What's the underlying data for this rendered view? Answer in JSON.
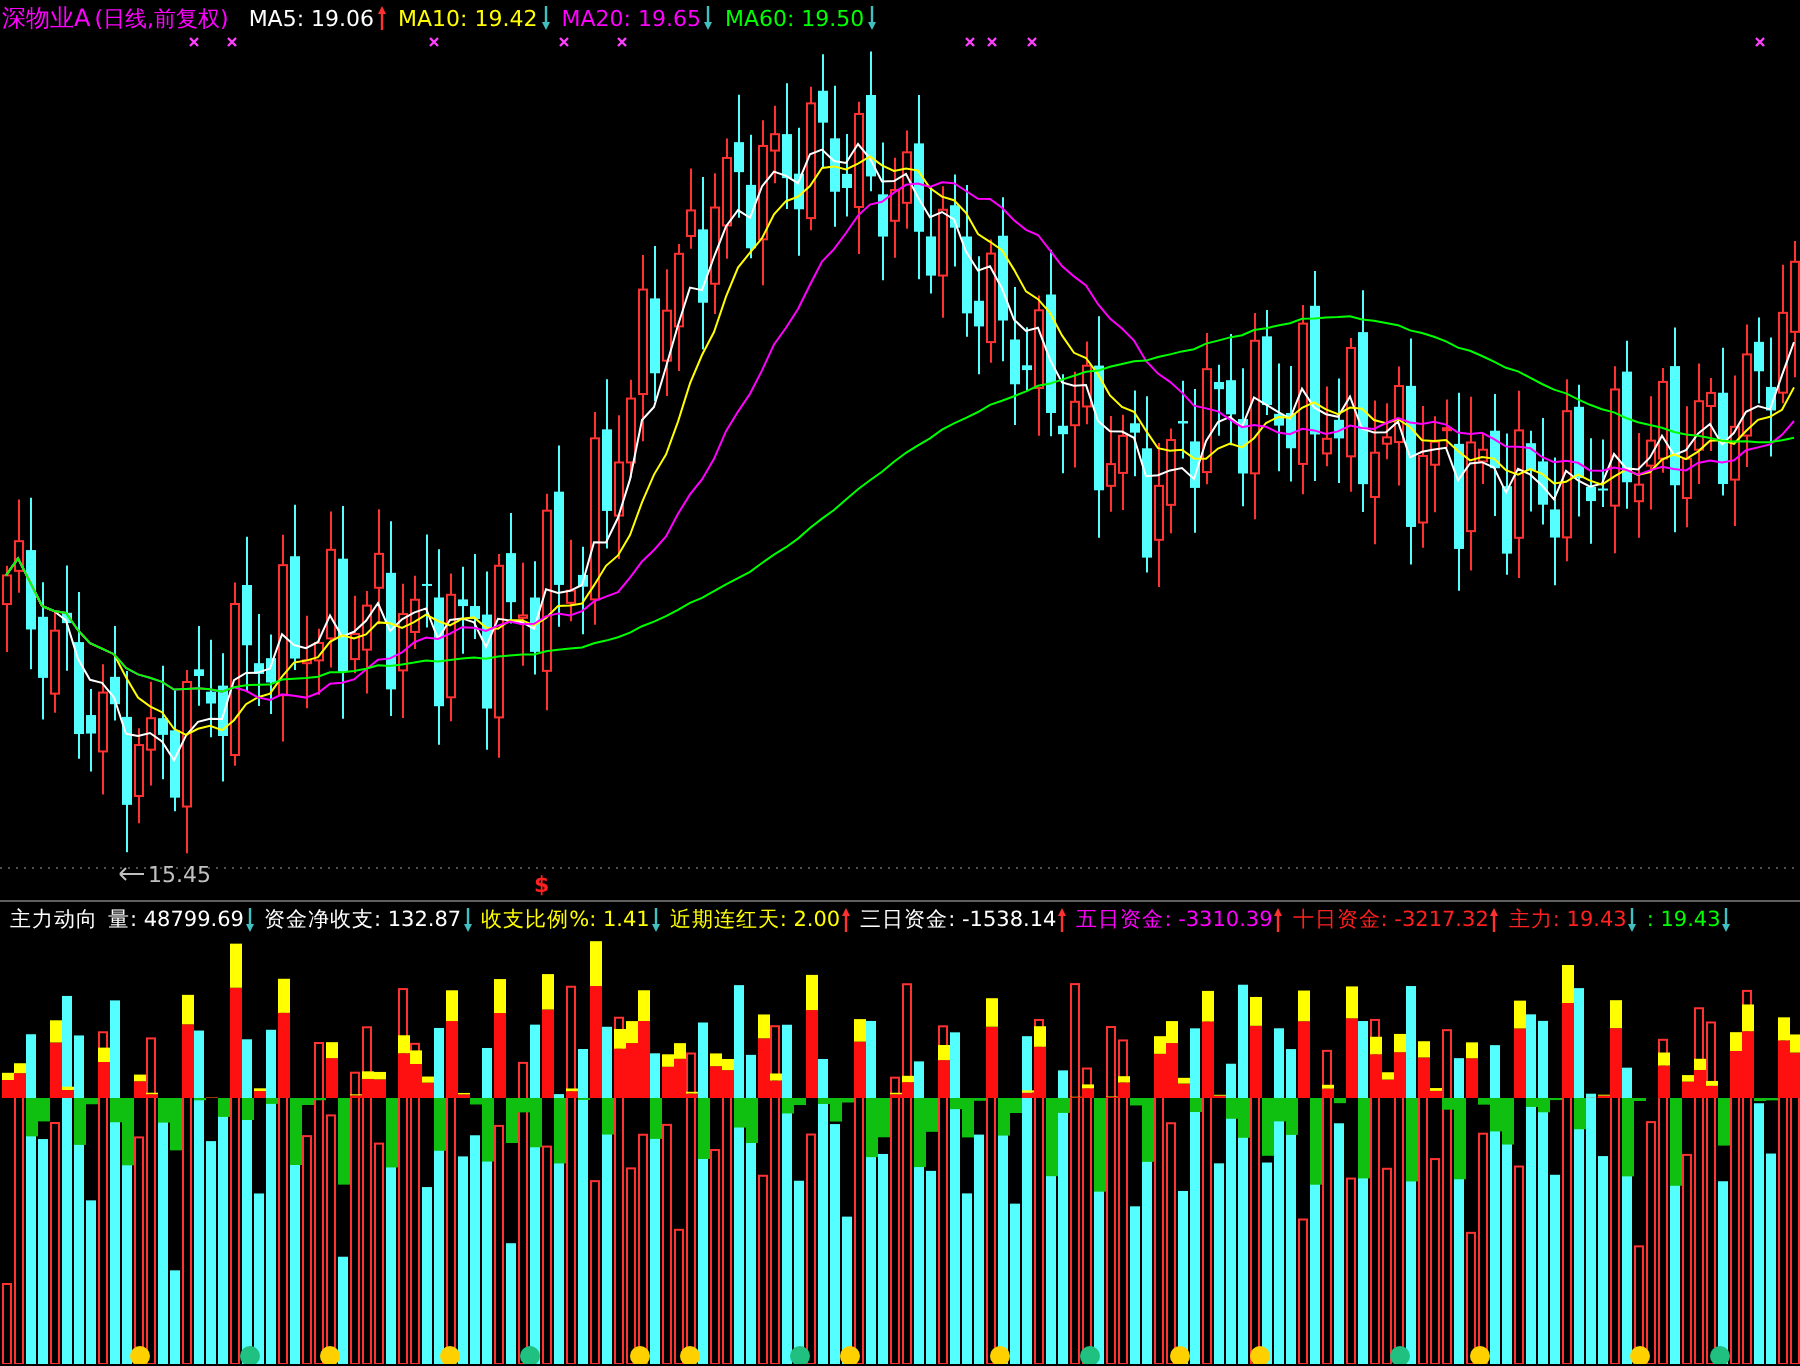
{
  "main_chart": {
    "security": "深物业A",
    "period": "(日线,前复权)",
    "indicators": [
      {
        "label": "MA5:",
        "value": "19.06",
        "color": "#ffffff",
        "rising": true
      },
      {
        "label": "MA10:",
        "value": "19.42",
        "color": "#ffff00",
        "rising": false
      },
      {
        "label": "MA20:",
        "value": "19.65",
        "color": "#ff00ff",
        "rising": false
      },
      {
        "label": "MA60:",
        "value": "19.50",
        "color": "#00ff00",
        "rising": false
      }
    ],
    "low_label": "15.45",
    "signal_mark": "$"
  },
  "sub_chart": {
    "name": "主力动向",
    "indicators": [
      {
        "label": "量:",
        "value": "48799.69",
        "color": "#ffffff",
        "rising": false
      },
      {
        "label": "资金净收支:",
        "value": "132.87",
        "color": "#ffffff",
        "rising": false
      },
      {
        "label": "收支比例%:",
        "value": "1.41",
        "color": "#ffff00",
        "rising": false
      },
      {
        "label": "近期连红天:",
        "value": "2.00",
        "color": "#ffff00",
        "rising": true
      },
      {
        "label": "三日资金:",
        "value": "-1538.14",
        "color": "#ffffff",
        "rising": true
      },
      {
        "label": "五日资金:",
        "value": "-3310.39",
        "color": "#ff00ff",
        "rising": true
      },
      {
        "label": "十日资金:",
        "value": "-3217.32",
        "color": "#ff2020",
        "rising": true
      },
      {
        "label": "主力:",
        "value": "19.43",
        "color": "#ff2020",
        "rising": false
      },
      {
        "label": ":",
        "value": "19.43",
        "color": "#00ff00",
        "rising": false
      }
    ]
  }
}
